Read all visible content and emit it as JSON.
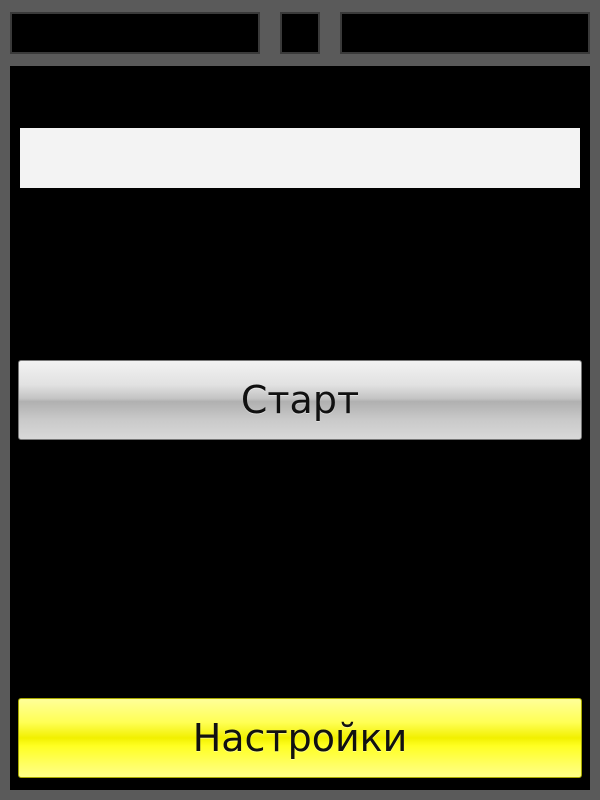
{
  "input": {
    "value": "",
    "placeholder": ""
  },
  "buttons": {
    "start_label": "Старт",
    "settings_label": "Настройки"
  },
  "colors": {
    "frame": "#5a5a5a",
    "panel": "#000000",
    "input_bg": "#f3f3f3",
    "start_button": "#c4c4c4",
    "settings_button": "#f2f000"
  }
}
